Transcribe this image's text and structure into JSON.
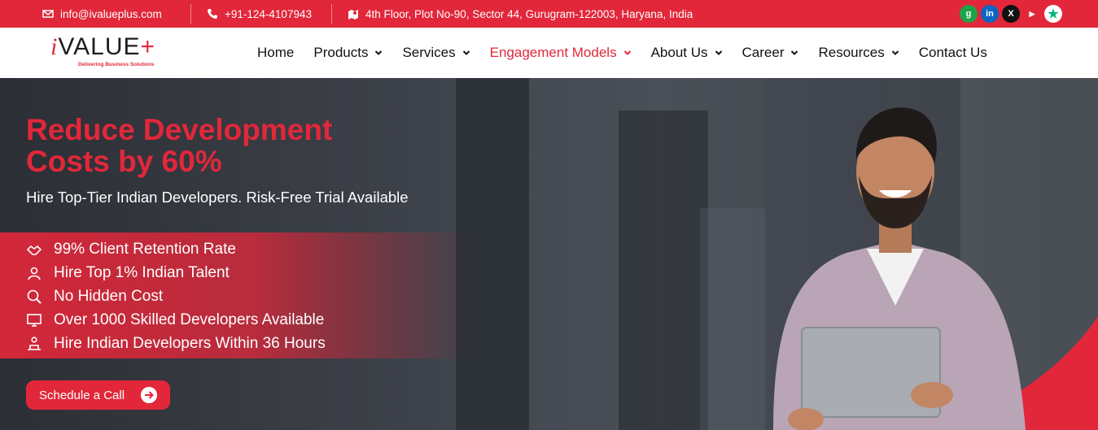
{
  "topbar": {
    "email": "info@ivalueplus.com",
    "phone": "+91-124-4107943",
    "address": "4th Floor, Plot No-90, Sector 44, Gurugram-122003, Haryana, India",
    "social": [
      {
        "icon": "glassdoor-icon",
        "label": "g",
        "color": "#1fa34a"
      },
      {
        "icon": "linkedin-icon",
        "label": "in",
        "color": "#0a66c2"
      },
      {
        "icon": "x-icon",
        "label": "X",
        "color": "#111111"
      },
      {
        "icon": "youtube-icon",
        "label": "▶",
        "color": "#e2273a"
      },
      {
        "icon": "trustpilot-icon",
        "label": "★",
        "color": "#00b67a"
      }
    ]
  },
  "logo": {
    "i": "i",
    "word": "VALUE",
    "plus": "+",
    "tagline": "Delivering Business Solutions"
  },
  "nav": [
    {
      "label": "Home",
      "dropdown": false,
      "active": false
    },
    {
      "label": "Products",
      "dropdown": true,
      "active": false
    },
    {
      "label": "Services",
      "dropdown": true,
      "active": false
    },
    {
      "label": "Engagement Models",
      "dropdown": true,
      "active": true
    },
    {
      "label": "About Us",
      "dropdown": true,
      "active": false
    },
    {
      "label": "Career",
      "dropdown": true,
      "active": false
    },
    {
      "label": "Resources",
      "dropdown": true,
      "active": false
    },
    {
      "label": "Contact Us",
      "dropdown": false,
      "active": false
    }
  ],
  "hero": {
    "title_line1": "Reduce Development",
    "title_line2": "Costs by 60%",
    "subtitle": "Hire Top-Tier Indian Developers. Risk-Free Trial Available",
    "features": [
      {
        "icon": "handshake-icon",
        "text": "99% Client Retention Rate"
      },
      {
        "icon": "talent-icon",
        "text": "Hire Top 1% Indian Talent"
      },
      {
        "icon": "search-cost-icon",
        "text": "No Hidden Cost"
      },
      {
        "icon": "developer-screen-icon",
        "text": "Over 1000 Skilled Developers Available"
      },
      {
        "icon": "developer-desk-icon",
        "text": "Hire Indian Developers Within 36 Hours"
      }
    ],
    "cta": "Schedule a Call"
  },
  "colors": {
    "brand_red": "#e2273a",
    "nav_text": "#111111",
    "hero_bg": "#3c4048"
  }
}
